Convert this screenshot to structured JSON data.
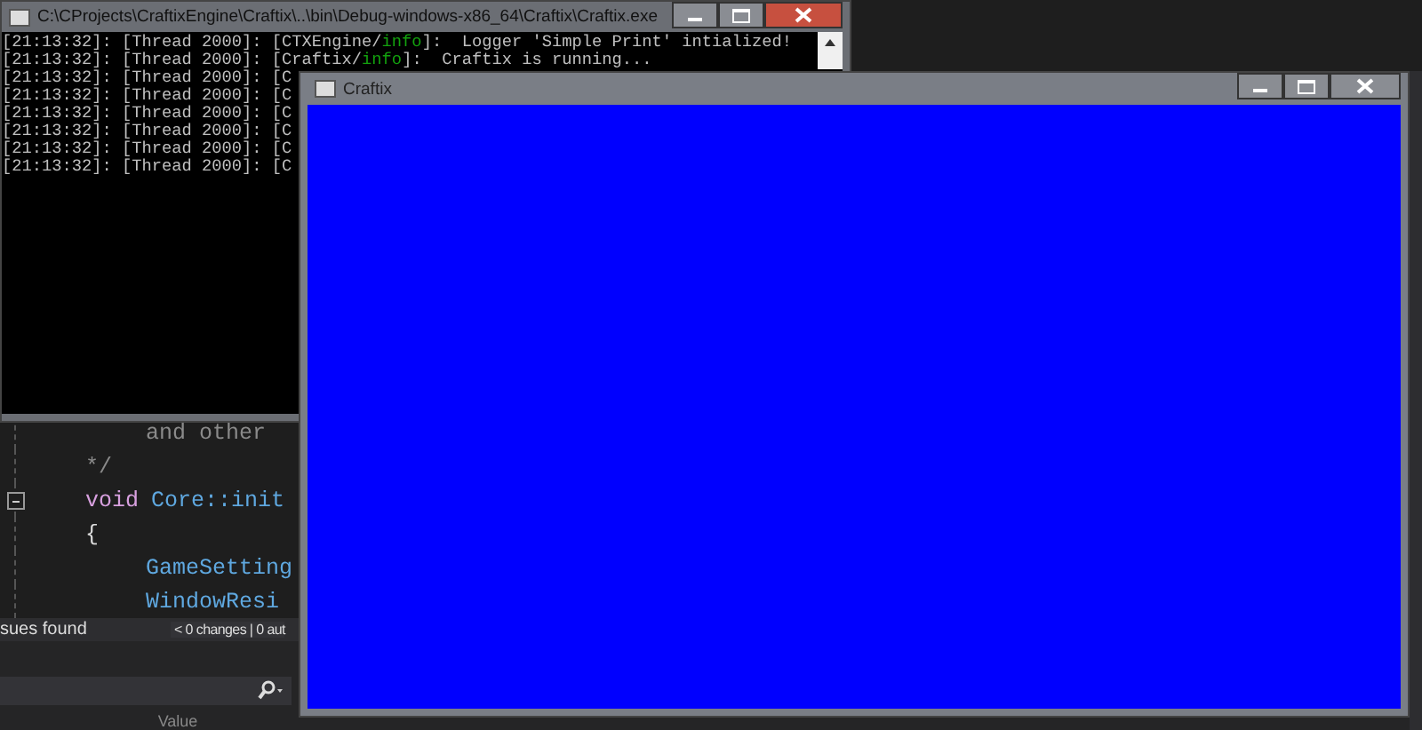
{
  "editor": {
    "lines": [
      {
        "children": [
          {
            "collapsible": false,
            "tokens": [
              {
                "kind": "comment",
                "text": "and other"
              }
            ]
          }
        ]
      },
      {
        "collapsible": false,
        "tokens": [
          {
            "kind": "comment",
            "text": "*/"
          }
        ]
      },
      {
        "collapsible": true,
        "tokens": [
          {
            "kind": "keyword",
            "text": "void"
          },
          {
            "kind": "name",
            "text": "Core::init"
          }
        ]
      },
      {
        "collapsible": false,
        "tokens": [
          {
            "kind": "plain",
            "text": "{"
          }
        ],
        "children": [
          {
            "collapsible": false,
            "tokens": [
              {
                "kind": "name",
                "text": "GameSetting"
              }
            ]
          },
          {
            "collapsible": false,
            "tokens": [
              {
                "kind": "name",
                "text": "WindowResi"
              }
            ]
          }
        ]
      }
    ],
    "status_left": "sues found",
    "status_right": "< 0 changes | 0 aut"
  },
  "panel": {
    "column_header": "Value"
  },
  "console_window": {
    "title": "C:\\CProjects\\CraftixEngine\\Craftix\\..\\bin\\Debug-windows-x86_64\\Craftix\\Craftix.exe",
    "lines": [
      {
        "prefix": "[21:13:32]: [Thread 2000]: [CTXEngine/",
        "level": "info",
        "suffix": "]:  Logger 'Simple Print' intialized!"
      },
      {
        "prefix": "[21:13:32]: [Thread 2000]: [Craftix/",
        "level": "info",
        "suffix": "]:  Craftix is running..."
      },
      {
        "prefix": "[21:13:32]: [Thread 2000]: [C"
      },
      {
        "prefix": "[21:13:32]: [Thread 2000]: [C"
      },
      {
        "prefix": "[21:13:32]: [Thread 2000]: [C"
      },
      {
        "prefix": "[21:13:32]: [Thread 2000]: [C"
      },
      {
        "prefix": "[21:13:32]: [Thread 2000]: [C"
      },
      {
        "prefix": "[21:13:32]: [Thread 2000]: [C"
      }
    ]
  },
  "game_window": {
    "title": "Craftix",
    "color": "#0000ff"
  }
}
